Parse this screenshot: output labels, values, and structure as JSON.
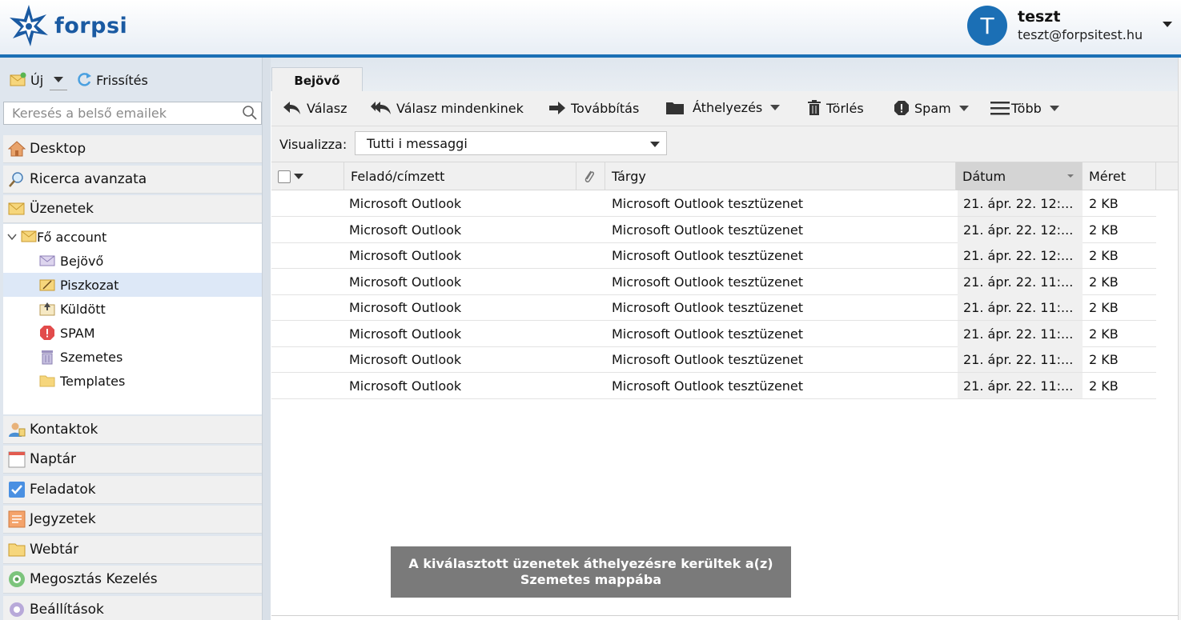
{
  "header": {
    "brand": "forpsi",
    "user_initial": "T",
    "user_name": "teszt",
    "user_email": "teszt@forpsitest.hu",
    "accent_color": "#1b6fb5"
  },
  "left_toolbar": {
    "new_label": "Új",
    "refresh_label": "Frissítés"
  },
  "search": {
    "placeholder": "Keresés a belső emailek"
  },
  "nav_top": [
    {
      "label": "Desktop",
      "icon": "home-icon"
    },
    {
      "label": "Ricerca avanzata",
      "icon": "magnifier-icon"
    },
    {
      "label": "Üzenetek",
      "icon": "envelope-icon"
    }
  ],
  "folders": {
    "account": "Fő account",
    "items": [
      {
        "label": "Bejövő",
        "icon": "inbox-icon"
      },
      {
        "label": "Piszkozat",
        "icon": "drafts-icon",
        "selected": true
      },
      {
        "label": "Küldött",
        "icon": "sent-icon"
      },
      {
        "label": "SPAM",
        "icon": "spam-icon"
      },
      {
        "label": "Szemetes",
        "icon": "trash-icon"
      },
      {
        "label": "Templates",
        "icon": "folder-icon"
      }
    ]
  },
  "nav_bottom": [
    {
      "label": "Kontaktok",
      "icon": "contacts-icon"
    },
    {
      "label": "Naptár",
      "icon": "calendar-icon"
    },
    {
      "label": "Feladatok",
      "icon": "tasks-icon"
    },
    {
      "label": "Jegyzetek",
      "icon": "notes-icon"
    },
    {
      "label": "Webtár",
      "icon": "folder-icon"
    },
    {
      "label": "Megosztás Kezelés",
      "icon": "share-icon"
    },
    {
      "label": "Beállítások",
      "icon": "settings-icon"
    }
  ],
  "tab": {
    "label": "Bejövő"
  },
  "toolbar": {
    "reply": "Válasz",
    "reply_all": "Válasz mindenkinek",
    "forward": "Továbbítás",
    "move": "Áthelyezés",
    "delete": "Törlés",
    "spam": "Spam",
    "more": "Több"
  },
  "filter": {
    "label": "Visualizza:",
    "selected": "Tutti i messaggi"
  },
  "columns": {
    "sender": "Feladó/címzett",
    "subject": "Tárgy",
    "date": "Dátum",
    "size": "Méret"
  },
  "messages": [
    {
      "sender": "Microsoft Outlook",
      "subject": "Microsoft Outlook tesztüzenet",
      "date": "21. ápr. 22. 12:...",
      "size": "2 KB"
    },
    {
      "sender": "Microsoft Outlook",
      "subject": "Microsoft Outlook tesztüzenet",
      "date": "21. ápr. 22. 12:...",
      "size": "2 KB"
    },
    {
      "sender": "Microsoft Outlook",
      "subject": "Microsoft Outlook tesztüzenet",
      "date": "21. ápr. 22. 12:...",
      "size": "2 KB"
    },
    {
      "sender": "Microsoft Outlook",
      "subject": "Microsoft Outlook tesztüzenet",
      "date": "21. ápr. 22. 11:...",
      "size": "2 KB"
    },
    {
      "sender": "Microsoft Outlook",
      "subject": "Microsoft Outlook tesztüzenet",
      "date": "21. ápr. 22. 11:...",
      "size": "2 KB"
    },
    {
      "sender": "Microsoft Outlook",
      "subject": "Microsoft Outlook tesztüzenet",
      "date": "21. ápr. 22. 11:...",
      "size": "2 KB"
    },
    {
      "sender": "Microsoft Outlook",
      "subject": "Microsoft Outlook tesztüzenet",
      "date": "21. ápr. 22. 11:...",
      "size": "2 KB"
    },
    {
      "sender": "Microsoft Outlook",
      "subject": "Microsoft Outlook tesztüzenet",
      "date": "21. ápr. 22. 11:...",
      "size": "2 KB"
    }
  ],
  "toast": {
    "text": "A kiválasztott üzenetek áthelyezésre kerültek a(z) Szemetes mappába"
  }
}
